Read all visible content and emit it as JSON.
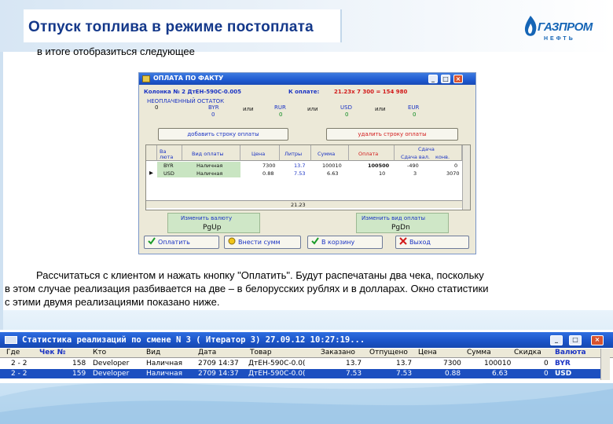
{
  "slide": {
    "title": "Отпуск топлива в режиме постоплата",
    "logo_text": "ГАЗПРОМ",
    "logo_sub": "НЕФТЬ",
    "intro": "в итоге отобразиться следующее",
    "para_line1": "Рассчитаться с клиентом и нажать кнопку \"Оплатить\". Будут распечатаны два чека, поскольку",
    "para_line2": "в этом случае реализация разбивается на две – в белорусских рублях и в долларах. Окно статистики",
    "para_line3": "с этими двумя реализациями показано ниже."
  },
  "dialog": {
    "title": "ОПЛАТА ПО ФАКТУ",
    "column_info": "Колонка № 2 ДтЕН-590С-0.005",
    "k_oplate_label": "К оплате:",
    "k_oplate_value": "21.23х  7 300 =  154 980",
    "unpaid_label": "НЕОПЛАЧЕННЫЙ ОСТАТОК",
    "currencies": [
      {
        "code": "BYR",
        "value": "0"
      },
      {
        "code": "RUR",
        "value": "0"
      },
      {
        "code": "USD",
        "value": "0"
      },
      {
        "code": "EUR",
        "value": "0"
      }
    ],
    "left_value": "0",
    "or_label": "или",
    "add_row_button": "добавить строку оплаты",
    "delete_row_button": "удалить строку оплаты",
    "grid": {
      "headers": [
        "Ва люта",
        "Вид оплаты",
        "Цена",
        "Литры",
        "Сумма",
        "Оплата",
        "Сдача вал.",
        "конв."
      ],
      "change_header": "Сдача",
      "rows": [
        {
          "cur": "BYR",
          "type": "Наличная",
          "price": "7300",
          "liters": "13.7",
          "sum": "100010",
          "paid": "100500",
          "change": "-490",
          "conv": "0"
        },
        {
          "cur": "USD",
          "type": "Наличная",
          "price": "0.88",
          "liters": "7.53",
          "sum": "6.63",
          "paid": "10",
          "change": "3",
          "conv": "3070"
        }
      ],
      "total_liters": "21.23"
    },
    "change_currency_label": "Изменить валюту",
    "change_currency_key": "PgUp",
    "change_type_label": "Изменить вид оплаты",
    "change_type_key": "PgDn",
    "btn_pay": "Оплатить",
    "btn_enter_sum": "Внести сумм",
    "btn_cart": "В корзину",
    "btn_exit": "Выход"
  },
  "stats": {
    "title": "Статистика реализаций по смене N 3 ( Итератор 3) 27.09.12 10:27:19...",
    "headers": [
      "Где",
      "Чек №",
      "Кто",
      "Вид",
      "Дата",
      "Товар",
      "Заказано",
      "Отпущено",
      "Цена",
      "Сумма",
      "Скидка",
      "Валюта"
    ],
    "rows": [
      {
        "where": "2 - 2",
        "check": "158",
        "who": "Developer",
        "kind": "Наличная",
        "date": "2709 14:37",
        "product": "ДтЕН-590С-0.0(",
        "ordered": "13.7",
        "released": "13.7",
        "price": "7300",
        "sum": "100010",
        "discount": "0",
        "currency": "BYR"
      },
      {
        "where": "2 - 2",
        "check": "159",
        "who": "Developer",
        "kind": "Наличная",
        "date": "2709 14:37",
        "product": "ДтЕН-590С-0.0(",
        "ordered": "7.53",
        "released": "7.53",
        "price": "0.88",
        "sum": "6.63",
        "discount": "0",
        "currency": "USD"
      }
    ]
  },
  "colors": {
    "title_blue": "#14388a",
    "xp_title": "#1f5ad0",
    "selection": "#1c4fc0",
    "key_green": "#cfe7c7"
  }
}
